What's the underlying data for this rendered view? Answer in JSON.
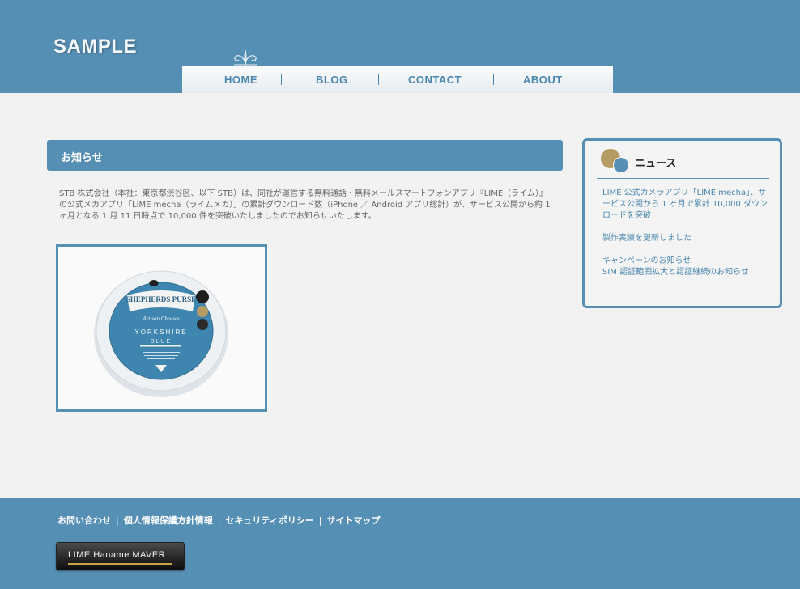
{
  "header": {
    "logo": "SAMPLE",
    "nav": [
      "HOME",
      "BLOG",
      "CONTACT",
      "ABOUT"
    ]
  },
  "main": {
    "title": "お知らせ",
    "body": "STB 株式会社（本社：東京都渋谷区、以下 STB）は、同社が運営する無料通話・無料メールスマートフォンアプリ『LIME（ライム）』の公式メカアプリ「LIME mecha（ライムメカ）」の累計ダウンロード数（iPhone ／ Android アプリ総計）が、サービス公開から約 1 ヶ月となる 1 月 11 日時点で 10,000 件を突破いたしましたのでお知らせいたします。",
    "photo": {
      "label_top": "SHEPHERDS PURSE",
      "label_sub": "Artisan Cheeses",
      "label_name1": "YORKSHIRE",
      "label_name2": "BLUE"
    }
  },
  "news": {
    "title": "ニュース",
    "items": [
      "LIME 公式カメラアプリ「LIME mecha」、サービス公開から 1 ヶ月で累計 10,000 ダウンロードを突破",
      "製作実績を更新しました",
      "キャンペーンのお知らせ",
      "SIM 認証範囲拡大と認証継続のお知らせ"
    ]
  },
  "footer": {
    "links": [
      "お問い合わせ",
      "個人情報保護方針情報",
      "セキュリティポリシー",
      "サイトマップ"
    ],
    "badge": "LIME Haname MAVER"
  },
  "colors": {
    "brand_blue": "#568fb4",
    "background": "#f2f2f2",
    "accent_gold": "#b59c63"
  }
}
